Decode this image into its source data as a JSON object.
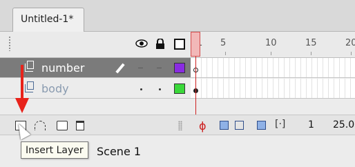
{
  "document_tab": {
    "title": "Untitled-1*"
  },
  "timeline": {
    "ruler_labels": [
      "1",
      "5",
      "10",
      "15",
      "20"
    ],
    "layers": [
      {
        "name": "number",
        "selected": true,
        "color": "#8a2be2"
      },
      {
        "name": "body",
        "selected": false,
        "color": "#3ad83a"
      }
    ]
  },
  "toolbar": {
    "current_frame": "1",
    "frame_rate": "25.0"
  },
  "scene": {
    "label": "Scene 1"
  },
  "tooltip": {
    "text": "Insert Layer"
  },
  "colors": {
    "playhead": "#cc1f1f",
    "selected_layer_bg": "#7b7b7b",
    "annotation_arrow": "#e8231b"
  },
  "icons": [
    "eye-icon",
    "lock-icon",
    "outline-icon",
    "pencil-icon",
    "new-layer-icon",
    "motion-guide-icon",
    "folder-icon",
    "trash-icon",
    "center-frame-icon",
    "onion-skin-icon",
    "onion-outline-icon",
    "edit-multiple-frames-icon",
    "modify-markers-icon"
  ]
}
